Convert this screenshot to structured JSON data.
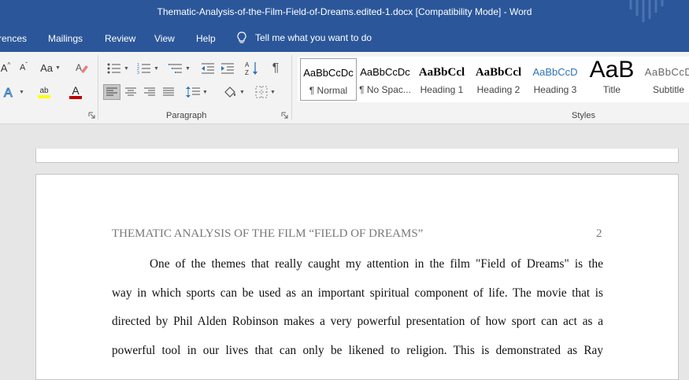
{
  "window": {
    "title": "Thematic-Analysis-of-the-Film-Field-of-Dreams.edited-1.docx [Compatibility Mode]  -  Word"
  },
  "ribbon_tabs": [
    {
      "label": "rences"
    },
    {
      "label": "Mailings"
    },
    {
      "label": "Review"
    },
    {
      "label": "View"
    },
    {
      "label": "Help"
    }
  ],
  "tell_me": {
    "label": "Tell me what you want to do"
  },
  "font_group": {
    "grow_label": "A",
    "shrink_label": "A",
    "case_label": "Aa",
    "highlight_label": "ab",
    "font_color_label": "A",
    "font_color": "#c00000",
    "highlight_color": "#ffff00"
  },
  "paragraph_group": {
    "label": "Paragraph",
    "sort_label": "A Z",
    "show_marks_label": "¶"
  },
  "styles_group": {
    "label": "Styles",
    "items": [
      {
        "sample": "AaBbCcDc",
        "name": "¶ Normal",
        "selected": true
      },
      {
        "sample": "AaBbCcDc",
        "name": "¶ No Spac..."
      },
      {
        "sample": "AaBbCcl",
        "name": "Heading 1"
      },
      {
        "sample": "AaBbCcl",
        "name": "Heading 2"
      },
      {
        "sample": "AaBbCcD",
        "name": "Heading 3"
      },
      {
        "sample": "AaB",
        "name": "Title"
      },
      {
        "sample": "AaBbCcD",
        "name": "Subtitle"
      }
    ]
  },
  "document": {
    "header": "THEMATIC ANALYSIS OF THE FILM “FIELD OF DREAMS”",
    "page_number": "2",
    "lines": [
      "One of the themes that really caught my attention in the film \"Field of Dreams\" is the",
      "way in which sports can be used as an important spiritual component of life. The movie that is",
      "directed by Phil Alden Robinson makes a very powerful presentation of how sport can act as a",
      "powerful tool in our lives that can only be likened to religion. This is demonstrated as Ray"
    ]
  },
  "colors": {
    "title_bar": "#2b579a",
    "ribbon": "#f3f3f3",
    "workspace": "#e6e6e6",
    "heading_blue": "#2e74b5"
  }
}
